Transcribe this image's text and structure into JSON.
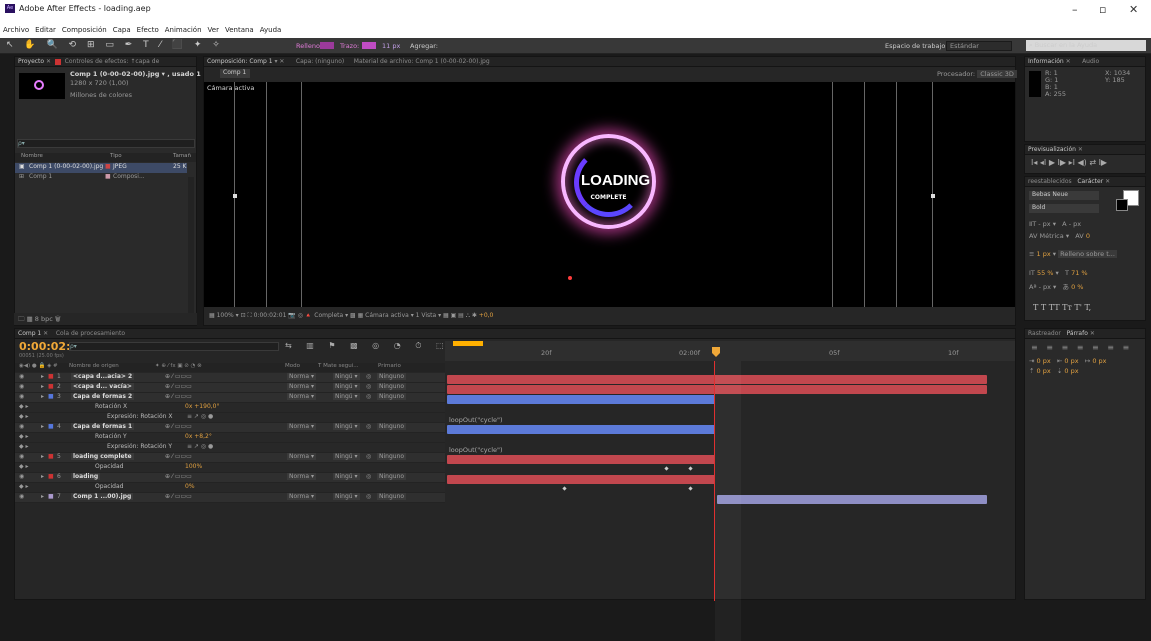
{
  "window": {
    "title": "Adobe After Effects - loading.aep",
    "app_icon": "Ae",
    "min": "–",
    "max": "▫",
    "close": "✕"
  },
  "menu": [
    "Archivo",
    "Editar",
    "Composición",
    "Capa",
    "Efecto",
    "Animación",
    "Ver",
    "Ventana",
    "Ayuda"
  ],
  "toolbar": {
    "fill": "Relleno:",
    "stroke": "Trazo:",
    "stroke_px": "11 px",
    "add": "Agregar:",
    "workspace_label": "Espacio de trabajo:",
    "workspace": "Estándar",
    "search": "Buscar en la Ayuda"
  },
  "project": {
    "tab1": "Proyecto",
    "tab2": "Controles de efectos: ↑capa de",
    "item_name": "Comp 1 (0-00-02-00).jpg ▾ , usado 1 vez",
    "item_size": "1280 x 720 (1,00)",
    "item_colors": "Millones de colores",
    "search_placeholder": "ρ▾",
    "col_name": "Nombre",
    "col_type": "Tipo",
    "col_size": "Tamañ",
    "rows": [
      {
        "name": "Comp 1 (0-00-02-00).jpg",
        "type": "JPEG",
        "size": "25 K"
      },
      {
        "name": "Comp 1",
        "type": "Composi...",
        "size": ""
      }
    ],
    "bpc": "8 bpc"
  },
  "comp": {
    "tab": "Composición: Comp 1",
    "layer_tab": "Capa: (ninguno)",
    "footage_tab": "Material de archivo: Comp 1 (0-00-02-00).jpg",
    "sub_tab": "Comp 1",
    "renderer": "Procesador:",
    "renderer_val": "Classic 3D",
    "active_camera": "Cámara activa",
    "loading": "LOADING",
    "complete": "COMPLETE",
    "zoom": "100%",
    "timecode": "0:00:02:01",
    "quality": "Completa",
    "camera": "Cámara activa",
    "views": "1 Vista",
    "exposure": "+0,0"
  },
  "info": {
    "tab": "Información",
    "tab2": "Audio",
    "r": "R: 1",
    "g": "G: 1",
    "b": "B: 1",
    "a": "A: 255",
    "x": "X: 1034",
    "y": "Y: 185"
  },
  "preview": {
    "tab": "Previsualización",
    "controls": "I◂  ◂I  ▶  I▶  ▸I  ◀)  ⇄  I▶"
  },
  "character": {
    "tab_pre": "reestablecidos",
    "tab": "Carácter",
    "font": "Bebas Neue",
    "style": "Bold",
    "size": "- px",
    "lead": "- px",
    "kern": "Métrica",
    "track": "0",
    "stroke_px": "1 px",
    "stroke_mode": "Relleno sobre t...",
    "vscale": "55 %",
    "hscale": "71 %",
    "baseline": "- px",
    "tsume": "0 %",
    "styles": "T  T  TT  Tт  T'  T,"
  },
  "paragraph": {
    "tab_pre": "Rastreador",
    "tab": "Párrafo",
    "indent": "0 px",
    "indent2": "0 px",
    "indent3": "0 px",
    "space": "0 px",
    "space2": "0 px"
  },
  "timeline": {
    "tab": "Comp 1",
    "tab2": "Cola de procesamiento",
    "time": "0:00:02:01",
    "fps": "00051 (25.00 fps)",
    "search": "ρ▾",
    "ruler": [
      "20f",
      "02:00f",
      "05f",
      "10f"
    ],
    "col_name": "Nombre de origen",
    "col_mode": "Modo",
    "col_mask": "T  Mate segui...",
    "col_parent": "Primario",
    "layers": [
      {
        "num": "1",
        "name": "<capa d...acia> 2",
        "mode": "Norma ▾",
        "mask": "Ningú ▾",
        "parent": "Ninguno"
      },
      {
        "num": "2",
        "name": "<capa d... vacía>",
        "mode": "Norma ▾",
        "mask": "Ningú ▾",
        "parent": "Ninguno"
      },
      {
        "num": "3",
        "name": "Capa de formas 2",
        "mode": "Norma ▾",
        "mask": "Ningú ▾",
        "parent": "Ninguno"
      },
      {
        "num": "",
        "name": "Rotación X",
        "value": "0x +190,0°"
      },
      {
        "num": "",
        "name": "Expresión: Rotación X",
        "expr": "loopOut(\"cycle\")"
      },
      {
        "num": "4",
        "name": "Capa de formas 1",
        "mode": "Norma ▾",
        "mask": "Ningú ▾",
        "parent": "Ninguno"
      },
      {
        "num": "",
        "name": "Rotación Y",
        "value": "0x +8,2°"
      },
      {
        "num": "",
        "name": "Expresión: Rotación Y",
        "expr": "loopOut(\"cycle\")"
      },
      {
        "num": "5",
        "name": "loading complete",
        "mode": "Norma ▾",
        "mask": "Ningú ▾",
        "parent": "Ninguno"
      },
      {
        "num": "",
        "name": "Opacidad",
        "value": "100%"
      },
      {
        "num": "6",
        "name": "loading",
        "mode": "Norma ▾",
        "mask": "Ningú ▾",
        "parent": "Ninguno"
      },
      {
        "num": "",
        "name": "Opacidad",
        "value": "0%"
      },
      {
        "num": "7",
        "name": "Comp 1 ...00).jpg",
        "mode": "Norma ▾",
        "mask": "Ningú ▾",
        "parent": "Ninguno"
      }
    ]
  }
}
